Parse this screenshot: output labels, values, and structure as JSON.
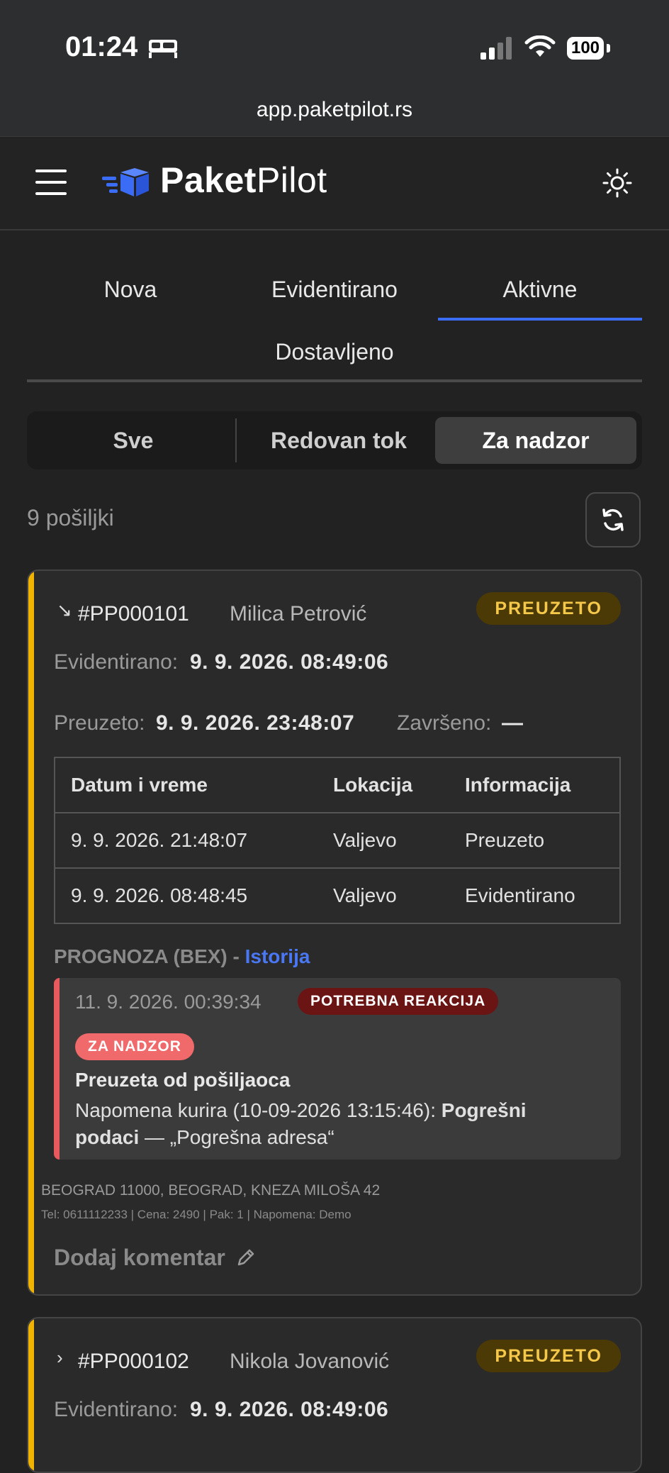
{
  "status_bar": {
    "time": "01:24",
    "battery": "100"
  },
  "browser": {
    "url": "app.paketpilot.rs"
  },
  "header": {
    "logo_bold": "Paket",
    "logo_light": "Pilot"
  },
  "tabs": [
    {
      "label": "Nova"
    },
    {
      "label": "Evidentirano"
    },
    {
      "label": "Aktivne"
    },
    {
      "label": "Dostavljeno"
    }
  ],
  "active_tab": "Aktivne",
  "filters": [
    {
      "label": "Sve"
    },
    {
      "label": "Redovan tok"
    },
    {
      "label": "Za nadzor"
    }
  ],
  "active_filter": "Za nadzor",
  "count_text": "9 pošiljki",
  "shipments": [
    {
      "id": "#PP000101",
      "name": "Milica Petrović",
      "status": "PREUZETO",
      "evidentirano_label": "Evidentirano:",
      "evidentirano_value": "9. 9. 2026. 08:49:06",
      "preuzeto_label": "Preuzeto:",
      "preuzeto_value": "9. 9. 2026. 23:48:07",
      "zavrseno_label": "Završeno:",
      "zavrseno_value": "—",
      "table": {
        "headers": [
          "Datum i vreme",
          "Lokacija",
          "Informacija"
        ],
        "rows": [
          [
            "9. 9. 2026. 21:48:07",
            "Valjevo",
            "Preuzeto"
          ],
          [
            "9. 9. 2026. 08:48:45",
            "Valjevo",
            "Evidentirano"
          ]
        ]
      },
      "prognoza_label": "PROGNOZA (BEX) - ",
      "istorija_link": "Istorija",
      "alert": {
        "date": "11. 9. 2026. 00:39:34",
        "badge": "POTREBNA REAKCIJA",
        "tag": "ZA NADZOR",
        "title": "Preuzeta od pošiljaoca",
        "note_prefix": "Napomena kurira (10-09-2026 13:15:46): ",
        "note_bold": "Pogrešni podaci",
        "note_suffix": " — „Pogrešna adresa“"
      },
      "address": "BEOGRAD 11000, BEOGRAD, KNEZA MILOŠA 42",
      "meta": "Tel: 0611112233 | Cena: 2490 | Pak: 1 | Napomena: Demo",
      "comment_label": "Dodaj komentar"
    },
    {
      "id": "#PP000102",
      "name": "Nikola Jovanović",
      "status": "PREUZETO",
      "evidentirano_label": "Evidentirano:",
      "evidentirano_value": "9. 9. 2026. 08:49:06"
    }
  ],
  "colors": {
    "accent_blue": "#3b6cf5",
    "card_accent": "#f0b400",
    "badge_preuzeto_bg": "#4b3a05",
    "badge_preuzeto_text": "#f5c84a",
    "alert_bar": "#e8595e"
  }
}
